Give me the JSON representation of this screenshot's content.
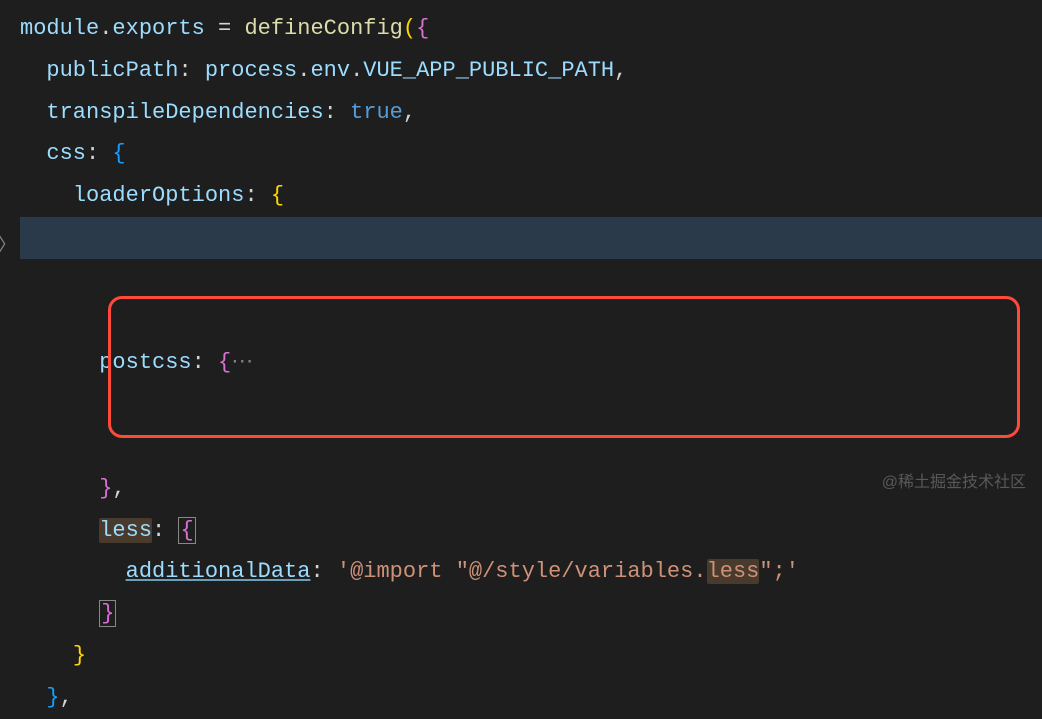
{
  "code": {
    "l1": {
      "module": "module",
      "dot": ".",
      "exports": "exports",
      "eq": " = ",
      "fn": "defineConfig",
      "op": "(",
      "brace": "{"
    },
    "l2": {
      "prop": "publicPath",
      "colon": ": ",
      "obj": "process",
      "d1": ".",
      "env": "env",
      "d2": ".",
      "var": "VUE_APP_PUBLIC_PATH",
      "comma": ","
    },
    "l3": {
      "prop": "transpileDependencies",
      "colon": ": ",
      "val": "true",
      "comma": ","
    },
    "l4": {
      "prop": "css",
      "colon": ": ",
      "brace": "{"
    },
    "l5": {
      "prop": "loaderOptions",
      "colon": ": ",
      "brace": "{"
    },
    "l6": {
      "prop": "postcss",
      "colon": ": ",
      "brace": "{",
      "fold": "⋯"
    },
    "l7": {
      "brace": "}",
      "comma": ","
    },
    "l8": {
      "prop": "less",
      "colon": ": ",
      "brace": "{"
    },
    "l9": {
      "prop": "additionalData",
      "colon": ": ",
      "str_full": "'@import \"@/style/variables.less\";'",
      "str_p1": "'@import \"@/style/variables.",
      "str_hl": "less",
      "str_p2": "\";'"
    },
    "l10": {
      "brace": "}"
    },
    "l11": {
      "brace": "}"
    },
    "l12": {
      "brace": "}",
      "comma": ","
    }
  },
  "watermark": "@稀土掘金技术社区",
  "indent": {
    "i1": "  ",
    "i2": "    ",
    "i3": "      ",
    "i4": "        "
  }
}
